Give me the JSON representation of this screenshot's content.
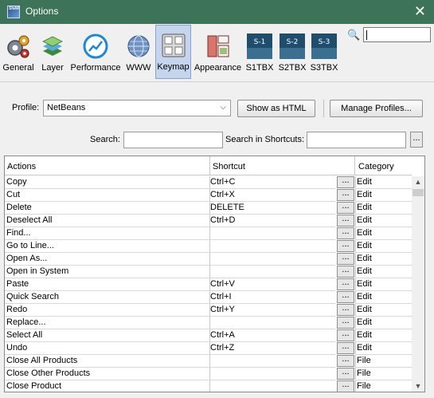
{
  "window": {
    "title": "Options",
    "close_glyph": "✕",
    "icon_text": "SNAP"
  },
  "categories": [
    {
      "label": "General",
      "icon": "gears-icon"
    },
    {
      "label": "Layer",
      "icon": "layers-icon"
    },
    {
      "label": "Performance",
      "icon": "gauge-icon"
    },
    {
      "label": "WWW",
      "icon": "globe-icon"
    },
    {
      "label": "Keymap",
      "icon": "keyboard-icon",
      "selected": true
    },
    {
      "label": "Appearance",
      "icon": "appearance-icon"
    },
    {
      "label": "S1TBX",
      "icon": "s1-icon",
      "badge": "S-1"
    },
    {
      "label": "S2TBX",
      "icon": "s2-icon",
      "badge": "S-2"
    },
    {
      "label": "S3TBX",
      "icon": "s3-icon",
      "badge": "S-3"
    }
  ],
  "top_search": {
    "icon": "search-icon",
    "glyph": "🔍",
    "value": ""
  },
  "profile": {
    "label": "Profile:",
    "value": "NetBeans",
    "show_html_label": "Show as HTML",
    "manage_label": "Manage Profiles..."
  },
  "search": {
    "label": "Search:",
    "value": "",
    "shortcuts_label": "Search in Shortcuts:",
    "shortcuts_value": "",
    "more_label": "..."
  },
  "table": {
    "columns": [
      "Actions",
      "Shortcut",
      "Category"
    ],
    "edit_label": "...",
    "rows": [
      {
        "action": "Copy",
        "shortcut": "Ctrl+C",
        "category": "Edit"
      },
      {
        "action": "Cut",
        "shortcut": "Ctrl+X",
        "category": "Edit"
      },
      {
        "action": "Delete",
        "shortcut": "DELETE",
        "category": "Edit"
      },
      {
        "action": "Deselect All",
        "shortcut": "Ctrl+D",
        "category": "Edit"
      },
      {
        "action": "Find...",
        "shortcut": "",
        "category": "Edit"
      },
      {
        "action": "Go to Line...",
        "shortcut": "",
        "category": "Edit"
      },
      {
        "action": "Open As...",
        "shortcut": "",
        "category": "Edit"
      },
      {
        "action": "Open in System",
        "shortcut": "",
        "category": "Edit"
      },
      {
        "action": "Paste",
        "shortcut": "Ctrl+V",
        "category": "Edit"
      },
      {
        "action": "Quick Search",
        "shortcut": "Ctrl+I",
        "category": "Edit"
      },
      {
        "action": "Redo",
        "shortcut": "Ctrl+Y",
        "category": "Edit"
      },
      {
        "action": "Replace...",
        "shortcut": "",
        "category": "Edit"
      },
      {
        "action": "Select All",
        "shortcut": "Ctrl+A",
        "category": "Edit"
      },
      {
        "action": "Undo",
        "shortcut": "Ctrl+Z",
        "category": "Edit"
      },
      {
        "action": "Close All Products",
        "shortcut": "",
        "category": "File"
      },
      {
        "action": "Close Other Products",
        "shortcut": "",
        "category": "File"
      },
      {
        "action": "Close Product",
        "shortcut": "",
        "category": "File"
      }
    ]
  },
  "colors": {
    "titlebar": "#3c7359",
    "selected_bg": "#c6d5ee"
  }
}
